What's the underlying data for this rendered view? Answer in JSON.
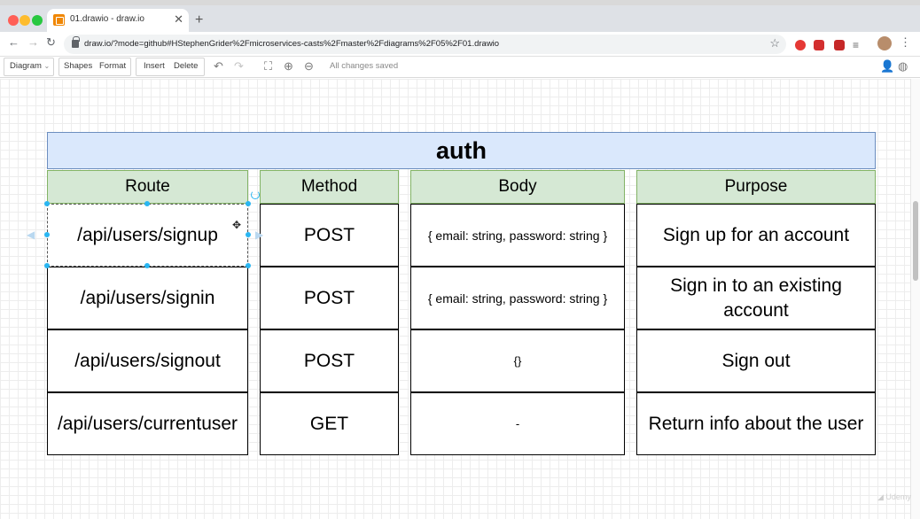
{
  "browser": {
    "tab_title": "01.drawio - draw.io",
    "tab_close": "✕",
    "new_tab": "+",
    "url": "draw.io/?mode=github#HStephenGrider%2Fmicroservices-casts%2Fmaster%2Fdiagrams%2F05%2F01.drawio",
    "icons": [
      "back-icon",
      "forward-icon",
      "reload-icon",
      "lock-icon",
      "star-icon",
      "kebab-menu-icon"
    ]
  },
  "toolbar": {
    "diagram": "Diagram",
    "shapes": "Shapes",
    "format": "Format",
    "insert": "Insert",
    "delete": "Delete",
    "status": "All changes saved"
  },
  "diagram": {
    "title": "auth",
    "headers": [
      "Route",
      "Method",
      "Body",
      "Purpose"
    ],
    "rows": [
      {
        "route": "/api/users/signup",
        "method": "POST",
        "body": "{ email: string, password: string }",
        "purpose": "Sign up for an account"
      },
      {
        "route": "/api/users/signin",
        "method": "POST",
        "body": "{ email: string, password: string }",
        "purpose": "Sign in to an existing account"
      },
      {
        "route": "/api/users/signout",
        "method": "POST",
        "body": "{}",
        "purpose": "Sign out"
      },
      {
        "route": "/api/users/currentuser",
        "method": "GET",
        "body": "-",
        "purpose": "Return info about the user"
      }
    ]
  },
  "colors": {
    "title_fill": "#dae8fc",
    "title_stroke": "#6c8ebf",
    "header_fill": "#d5e8d4",
    "header_stroke": "#82b366",
    "selection_handle": "#29b6f2"
  }
}
